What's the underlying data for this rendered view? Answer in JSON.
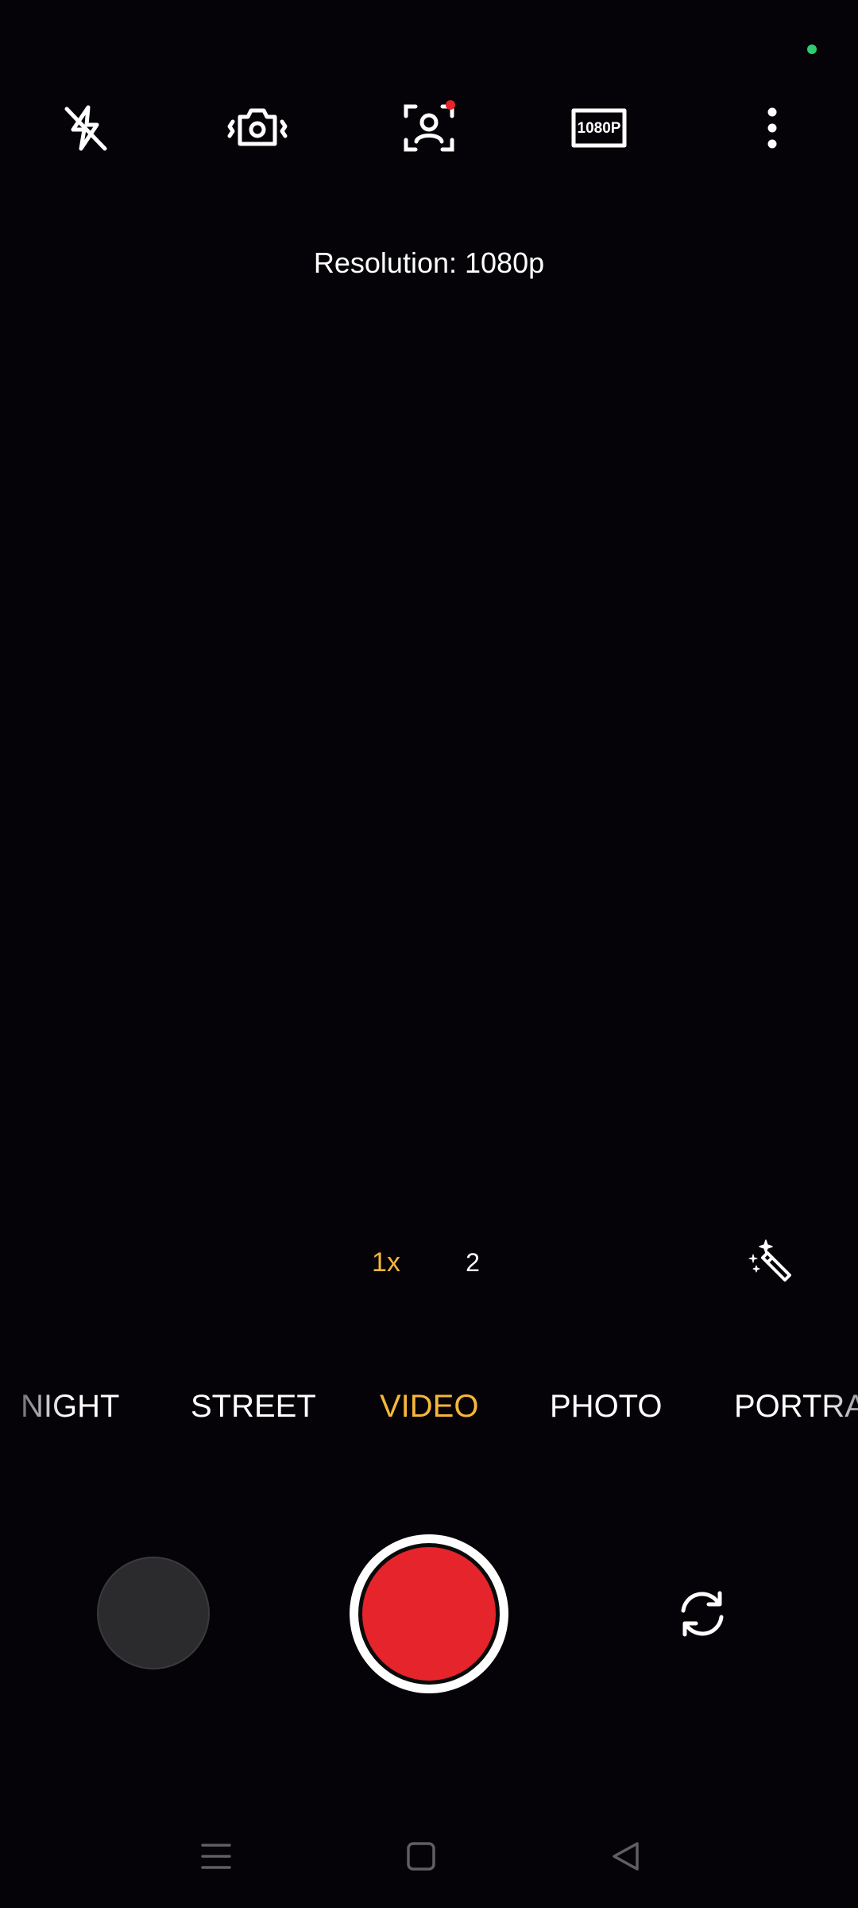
{
  "status": {
    "indicator_color": "#2ecc71"
  },
  "top_bar": {
    "icons": [
      "flash-off-icon",
      "stabilization-icon",
      "face-detect-icon",
      "resolution-1080p-icon",
      "more-options-icon"
    ],
    "resolution_badge": "1080P",
    "notification_dot_color": "#e5242b"
  },
  "hint": {
    "resolution_text": "Resolution: 1080p"
  },
  "zoom": {
    "current": "1x",
    "option": "2",
    "active_color": "#f5b73a"
  },
  "filters": {
    "icon": "magic-wand-icon"
  },
  "modes": {
    "items": [
      "NIGHT",
      "STREET",
      "VIDEO",
      "PHOTO",
      "PORTRAIT"
    ],
    "selected": "VIDEO",
    "selected_color": "#f5b73a"
  },
  "controls": {
    "gallery_icon": "gallery-thumbnail",
    "shutter_icon": "record-button",
    "shutter_color": "#e5242b",
    "flip_icon": "switch-camera-icon"
  },
  "nav": {
    "icons": [
      "recent-apps-icon",
      "home-icon",
      "back-icon"
    ]
  }
}
